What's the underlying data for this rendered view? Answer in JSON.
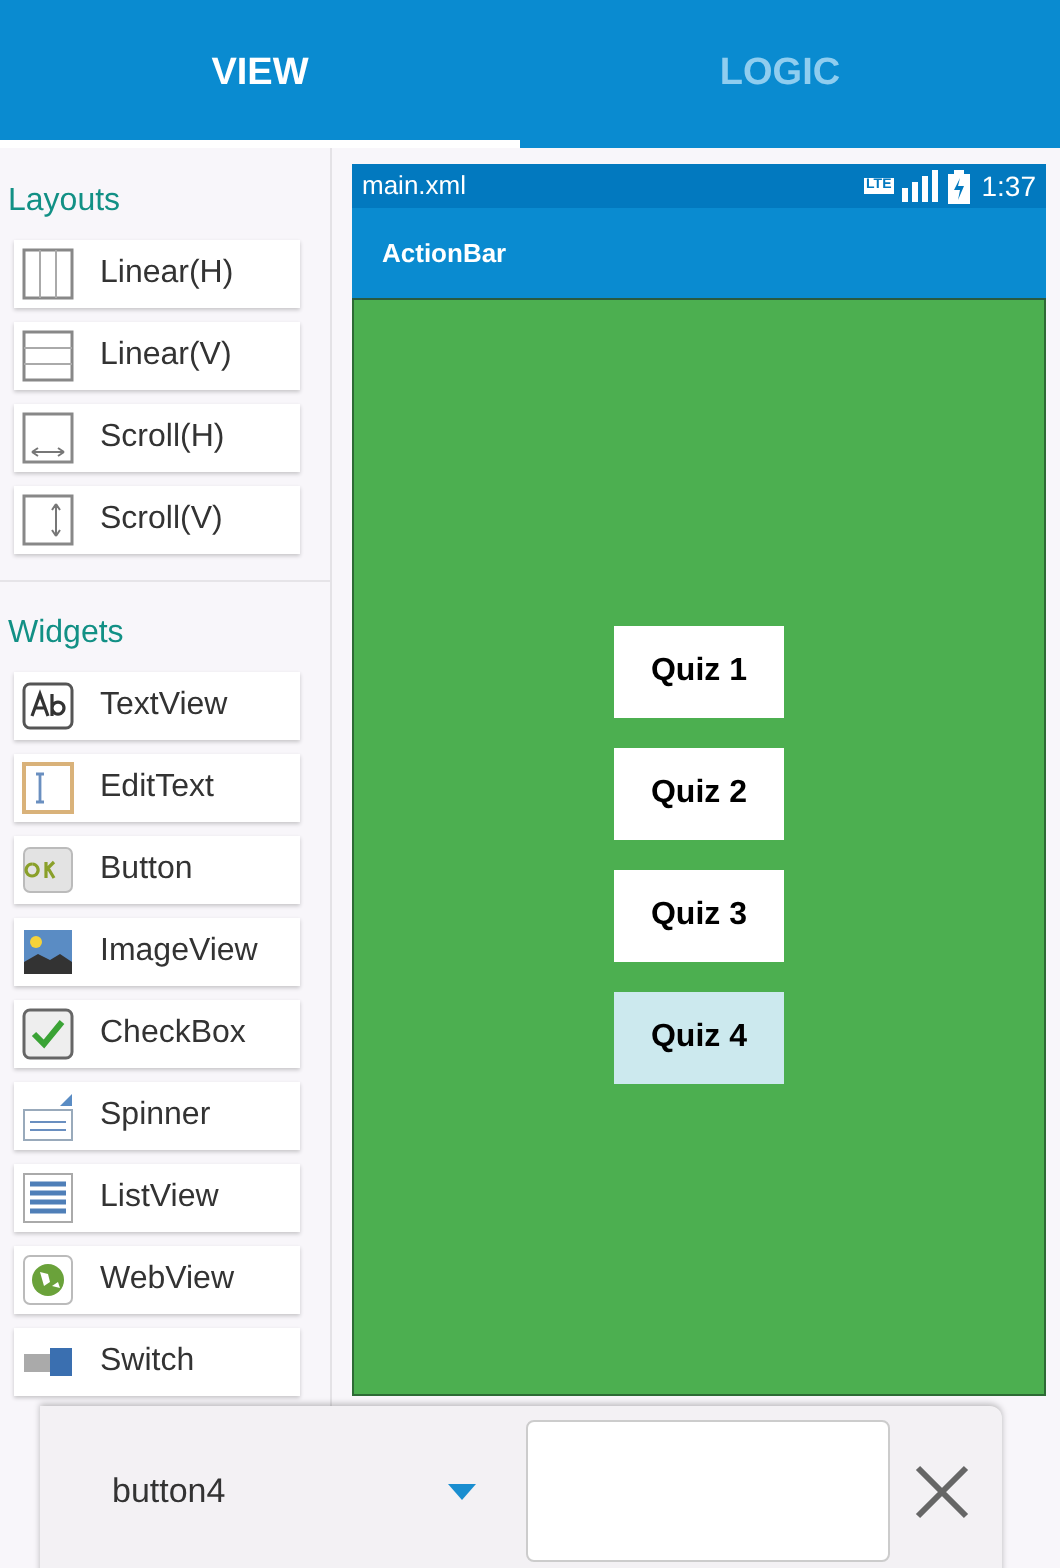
{
  "tabs": [
    {
      "label": "VIEW",
      "selected": true
    },
    {
      "label": "LOGIC",
      "selected": false
    }
  ],
  "palette": {
    "sections": [
      {
        "title": "Layouts",
        "items": [
          {
            "label": "Linear(H)"
          },
          {
            "label": "Linear(V)"
          },
          {
            "label": "Scroll(H)"
          },
          {
            "label": "Scroll(V)"
          }
        ]
      },
      {
        "title": "Widgets",
        "items": [
          {
            "label": "TextView"
          },
          {
            "label": "EditText"
          },
          {
            "label": "Button"
          },
          {
            "label": "ImageView"
          },
          {
            "label": "CheckBox"
          },
          {
            "label": "Spinner"
          },
          {
            "label": "ListView"
          },
          {
            "label": "WebView"
          },
          {
            "label": "Switch"
          }
        ]
      }
    ]
  },
  "preview": {
    "file": "main.xml",
    "network": "LTE",
    "time": "1:37",
    "action_bar": "ActionBar",
    "buttons": [
      {
        "label": "Quiz 1",
        "selected": false
      },
      {
        "label": "Quiz 2",
        "selected": false
      },
      {
        "label": "Quiz 3",
        "selected": false
      },
      {
        "label": "Quiz 4",
        "selected": true
      }
    ]
  },
  "property_bar": {
    "widget": "button4"
  }
}
